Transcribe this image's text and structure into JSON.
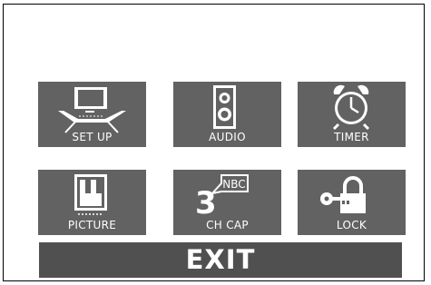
{
  "menu": {
    "items": [
      {
        "label": "SET UP",
        "icon": "tv-setup-icon"
      },
      {
        "label": "AUDIO",
        "icon": "speaker-icon"
      },
      {
        "label": "TIMER",
        "icon": "alarm-clock-icon"
      },
      {
        "label": "PICTURE",
        "icon": "picture-bars-icon"
      },
      {
        "label": "CH CAP",
        "icon": "channel-caption-icon",
        "icon_text": {
          "number": "3",
          "network": "NBC"
        }
      },
      {
        "label": "LOCK",
        "icon": "key-lock-icon"
      }
    ],
    "exit_label": "EXIT"
  },
  "colors": {
    "tile": "#626262",
    "exit_bar": "#505050",
    "text": "#ffffff",
    "background": "#ffffff"
  }
}
